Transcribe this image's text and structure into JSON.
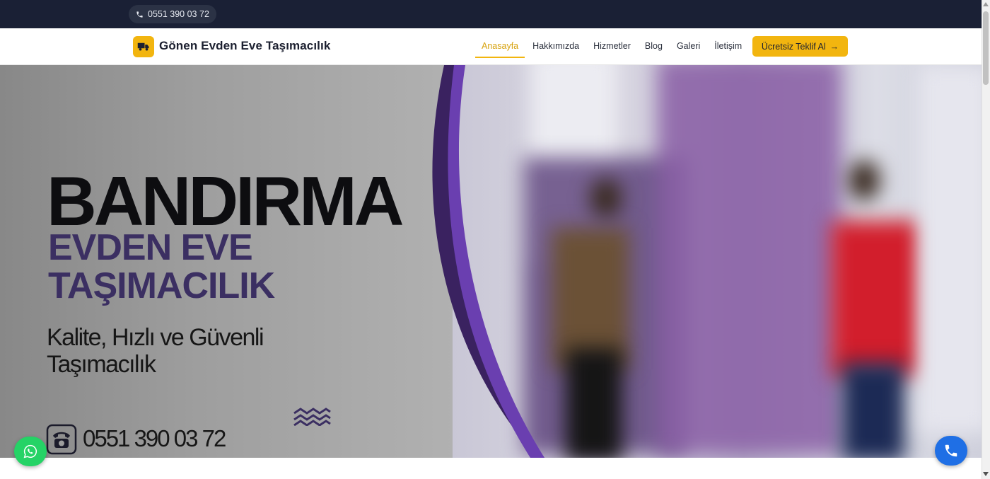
{
  "topbar": {
    "phone": "0551 390 03 72"
  },
  "navbar": {
    "brand": "Gönen Evden Eve Taşımacılık",
    "items": [
      {
        "label": "Anasayfa",
        "active": true
      },
      {
        "label": "Hakkımızda",
        "active": false
      },
      {
        "label": "Hizmetler",
        "active": false
      },
      {
        "label": "Blog",
        "active": false
      },
      {
        "label": "Galeri",
        "active": false
      },
      {
        "label": "İletişim",
        "active": false
      }
    ],
    "cta_label": "Ücretsiz Teklif Al",
    "cta_arrow": "→"
  },
  "hero": {
    "title": "BANDIRMA",
    "subtitle_line1": "EVDEN EVE",
    "subtitle_line2": "TAŞIMACILIK",
    "tagline_line1": "Kalite, Hızlı ve Güvenli",
    "tagline_line2": "Taşımacılık",
    "phone": "0551 390 03 72"
  },
  "colors": {
    "topbar": "#1a2035",
    "accent": "#f2b50f",
    "purple": "#6a3fb0",
    "whatsapp": "#25d366",
    "call": "#1f6fe5"
  },
  "icons": [
    "phone-icon",
    "truck-icon",
    "arrow-right-icon",
    "telephone-icon",
    "waves-icon",
    "whatsapp-icon",
    "call-icon"
  ]
}
